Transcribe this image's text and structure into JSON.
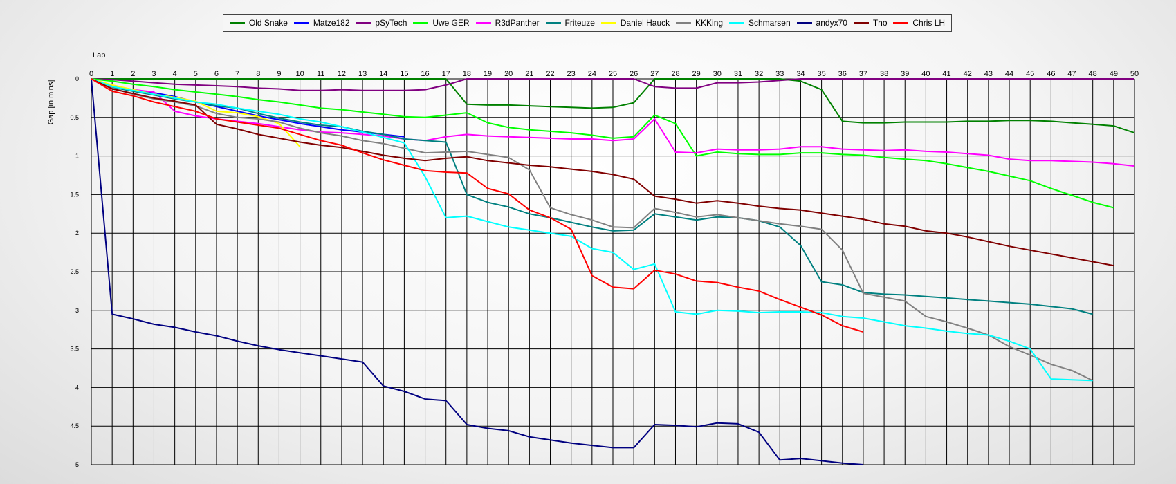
{
  "chart_data": {
    "type": "line",
    "xlabel": "Lap",
    "ylabel": "Gap [in mins]",
    "x_range": [
      0,
      50
    ],
    "y_range": [
      0,
      5
    ],
    "y_inverted": true,
    "x_ticks": [
      0,
      1,
      2,
      3,
      4,
      5,
      6,
      7,
      8,
      9,
      10,
      11,
      12,
      13,
      14,
      15,
      16,
      17,
      18,
      19,
      20,
      21,
      22,
      23,
      24,
      25,
      26,
      27,
      28,
      29,
      30,
      31,
      32,
      33,
      34,
      35,
      36,
      37,
      38,
      39,
      40,
      41,
      42,
      43,
      44,
      45,
      46,
      47,
      48,
      49,
      50
    ],
    "y_ticks": [
      "0",
      "0.5",
      "1",
      "1.5",
      "2",
      "2.5",
      "3",
      "3.5",
      "4",
      "4.5",
      "5"
    ],
    "grid": true,
    "legend_position": "top",
    "series": [
      {
        "name": "Old Snake",
        "color": "#008000",
        "x": [
          0,
          1,
          2,
          3,
          4,
          5,
          6,
          7,
          8,
          9,
          10,
          11,
          12,
          13,
          14,
          15,
          16,
          17,
          18,
          19,
          20,
          21,
          22,
          23,
          24,
          25,
          26,
          27,
          28,
          29,
          30,
          31,
          32,
          33,
          34,
          35,
          36,
          37,
          38,
          39,
          40,
          41,
          42,
          43,
          44,
          45,
          46,
          47,
          48,
          49,
          50
        ],
        "y": [
          0,
          0,
          0,
          0,
          0,
          0,
          0,
          0,
          0,
          0,
          0,
          0,
          0,
          0,
          0,
          0,
          0,
          0,
          0.33,
          0.34,
          0.34,
          0.35,
          0.36,
          0.37,
          0.38,
          0.37,
          0.31,
          0,
          0,
          0,
          0,
          0,
          0,
          0,
          0.03,
          0.14,
          0.55,
          0.57,
          0.57,
          0.56,
          0.56,
          0.56,
          0.55,
          0.55,
          0.54,
          0.54,
          0.55,
          0.57,
          0.59,
          0.61,
          0.7
        ]
      },
      {
        "name": "Matze182",
        "color": "#0000ff",
        "x": [
          0,
          1,
          2,
          3,
          4,
          5,
          6,
          7,
          8,
          9,
          10,
          11,
          12,
          13,
          14,
          15
        ],
        "y": [
          0,
          0.09,
          0.14,
          0.18,
          0.23,
          0.3,
          0.36,
          0.42,
          0.48,
          0.53,
          0.58,
          0.62,
          0.66,
          0.69,
          0.72,
          0.75
        ]
      },
      {
        "name": "pSyTech",
        "color": "#800080",
        "x": [
          0,
          1,
          2,
          3,
          4,
          5,
          6,
          7,
          8,
          9,
          10,
          11,
          12,
          13,
          14,
          15,
          16,
          17,
          18,
          19,
          20,
          21,
          22,
          23,
          24,
          25,
          26,
          27,
          28,
          29,
          30,
          31,
          32,
          33,
          34,
          35,
          36,
          37,
          38,
          39,
          40,
          41,
          42,
          43,
          44,
          45,
          46,
          47,
          48,
          49,
          50
        ],
        "y": [
          0,
          0.01,
          0.03,
          0.05,
          0.07,
          0.08,
          0.09,
          0.1,
          0.12,
          0.13,
          0.15,
          0.15,
          0.14,
          0.15,
          0.15,
          0.15,
          0.14,
          0.08,
          0,
          0,
          0,
          0,
          0,
          0,
          0,
          0,
          0,
          0.1,
          0.12,
          0.12,
          0.05,
          0.05,
          0.04,
          0.02,
          0,
          0,
          0,
          0,
          0,
          0,
          0,
          0,
          0,
          0,
          0,
          0,
          0,
          0,
          0,
          0,
          0
        ]
      },
      {
        "name": "Uwe GER",
        "color": "#00ff00",
        "x": [
          0,
          1,
          2,
          3,
          4,
          5,
          6,
          7,
          8,
          9,
          10,
          11,
          12,
          13,
          14,
          15,
          16,
          17,
          18,
          19,
          20,
          21,
          22,
          23,
          24,
          25,
          26,
          27,
          28,
          29,
          30,
          31,
          32,
          33,
          34,
          35,
          36,
          37,
          38,
          39,
          40,
          41,
          42,
          43,
          44,
          45,
          46,
          47,
          48,
          49
        ],
        "y": [
          0,
          0.03,
          0.07,
          0.1,
          0.14,
          0.17,
          0.2,
          0.23,
          0.27,
          0.3,
          0.34,
          0.38,
          0.4,
          0.43,
          0.46,
          0.49,
          0.5,
          0.47,
          0.44,
          0.57,
          0.63,
          0.66,
          0.68,
          0.7,
          0.73,
          0.77,
          0.75,
          0.47,
          0.58,
          1.0,
          0.95,
          0.97,
          0.98,
          0.98,
          0.96,
          0.96,
          0.98,
          0.99,
          1.02,
          1.04,
          1.06,
          1.1,
          1.15,
          1.2,
          1.26,
          1.32,
          1.42,
          1.51,
          1.6,
          1.67
        ]
      },
      {
        "name": "R3dPanther",
        "color": "#ff00ff",
        "x": [
          0,
          1,
          2,
          3,
          4,
          5,
          6,
          7,
          8,
          9,
          10,
          11,
          12,
          13,
          14,
          15,
          16,
          17,
          18,
          19,
          20,
          21,
          22,
          23,
          24,
          25,
          26,
          27,
          28,
          29,
          30,
          31,
          32,
          33,
          34,
          35,
          36,
          37,
          38,
          39,
          40,
          41,
          42,
          43,
          44,
          45,
          46,
          47,
          48,
          49,
          50
        ],
        "y": [
          0,
          0.1,
          0.14,
          0.17,
          0.42,
          0.48,
          0.52,
          0.55,
          0.58,
          0.62,
          0.66,
          0.69,
          0.7,
          0.72,
          0.74,
          0.78,
          0.8,
          0.75,
          0.72,
          0.74,
          0.75,
          0.76,
          0.77,
          0.78,
          0.78,
          0.8,
          0.78,
          0.52,
          0.95,
          0.96,
          0.91,
          0.92,
          0.92,
          0.91,
          0.88,
          0.88,
          0.91,
          0.92,
          0.93,
          0.92,
          0.94,
          0.95,
          0.97,
          0.99,
          1.04,
          1.06,
          1.06,
          1.07,
          1.08,
          1.1,
          1.13
        ]
      },
      {
        "name": "Friteuze",
        "color": "#008080",
        "x": [
          0,
          1,
          2,
          3,
          4,
          5,
          6,
          7,
          8,
          9,
          10,
          11,
          12,
          13,
          14,
          15,
          16,
          17,
          18,
          19,
          20,
          21,
          22,
          23,
          24,
          25,
          26,
          27,
          28,
          29,
          30,
          31,
          32,
          33,
          34,
          35,
          36,
          37,
          38,
          39,
          40,
          41,
          42,
          43,
          44,
          45,
          46,
          47,
          48
        ],
        "y": [
          0,
          0.11,
          0.16,
          0.21,
          0.26,
          0.3,
          0.35,
          0.38,
          0.45,
          0.51,
          0.56,
          0.6,
          0.62,
          0.68,
          0.72,
          0.78,
          0.8,
          0.82,
          1.5,
          1.6,
          1.66,
          1.75,
          1.8,
          1.86,
          1.92,
          1.97,
          1.96,
          1.75,
          1.79,
          1.83,
          1.79,
          1.8,
          1.84,
          1.92,
          2.16,
          2.63,
          2.67,
          2.77,
          2.79,
          2.8,
          2.82,
          2.84,
          2.86,
          2.88,
          2.9,
          2.92,
          2.95,
          2.98,
          3.05
        ]
      },
      {
        "name": "Daniel Hauck",
        "color": "#ffff00",
        "x": [
          0,
          1,
          2,
          3,
          4,
          5,
          6,
          7,
          8,
          9,
          10
        ],
        "y": [
          0,
          0.08,
          0.14,
          0.2,
          0.24,
          0.29,
          0.42,
          0.44,
          0.49,
          0.58,
          0.88
        ]
      },
      {
        "name": "KKKing",
        "color": "#808080",
        "x": [
          0,
          1,
          2,
          3,
          4,
          5,
          6,
          7,
          8,
          9,
          10,
          11,
          12,
          13,
          14,
          15,
          16,
          17,
          18,
          19,
          20,
          21,
          22,
          23,
          24,
          25,
          26,
          27,
          28,
          29,
          30,
          31,
          32,
          33,
          34,
          35,
          36,
          37,
          38,
          39,
          40,
          41,
          42,
          43,
          44,
          45,
          46,
          47,
          48
        ],
        "y": [
          0,
          0.12,
          0.2,
          0.26,
          0.3,
          0.35,
          0.45,
          0.5,
          0.52,
          0.56,
          0.64,
          0.7,
          0.74,
          0.8,
          0.84,
          0.9,
          0.96,
          0.95,
          0.94,
          0.98,
          1.02,
          1.18,
          1.67,
          1.76,
          1.83,
          1.92,
          1.93,
          1.68,
          1.73,
          1.79,
          1.76,
          1.8,
          1.84,
          1.88,
          1.91,
          1.95,
          2.22,
          2.78,
          2.83,
          2.88,
          3.08,
          3.15,
          3.23,
          3.32,
          3.47,
          3.58,
          3.7,
          3.78,
          3.91
        ]
      },
      {
        "name": "Schmarsen",
        "color": "#00ffff",
        "x": [
          0,
          1,
          2,
          3,
          4,
          5,
          6,
          7,
          8,
          9,
          10,
          11,
          12,
          13,
          14,
          15,
          16,
          17,
          18,
          19,
          20,
          21,
          22,
          23,
          24,
          25,
          26,
          27,
          28,
          29,
          30,
          31,
          32,
          33,
          34,
          35,
          36,
          37,
          38,
          39,
          40,
          41,
          42,
          43,
          44,
          45,
          46,
          47,
          48
        ],
        "y": [
          0,
          0.1,
          0.15,
          0.2,
          0.25,
          0.3,
          0.33,
          0.38,
          0.42,
          0.46,
          0.52,
          0.56,
          0.62,
          0.69,
          0.76,
          0.83,
          1.27,
          1.8,
          1.78,
          1.85,
          1.92,
          1.96,
          2.0,
          2.04,
          2.2,
          2.25,
          2.47,
          2.4,
          3.02,
          3.05,
          3.0,
          3.01,
          3.03,
          3.02,
          3.02,
          3.03,
          3.08,
          3.1,
          3.15,
          3.2,
          3.23,
          3.27,
          3.3,
          3.32,
          3.4,
          3.5,
          3.89,
          3.9,
          3.91
        ]
      },
      {
        "name": "andyx70",
        "color": "#000080",
        "x": [
          0,
          1,
          2,
          3,
          4,
          5,
          6,
          7,
          8,
          9,
          10,
          11,
          12,
          13,
          14,
          15,
          16,
          17,
          18,
          19,
          20,
          21,
          22,
          23,
          24,
          25,
          26,
          27,
          28,
          29,
          30,
          31,
          32,
          33,
          34,
          35,
          36,
          37
        ],
        "y": [
          0,
          3.05,
          3.11,
          3.18,
          3.22,
          3.28,
          3.33,
          3.4,
          3.46,
          3.51,
          3.55,
          3.59,
          3.63,
          3.67,
          3.98,
          4.05,
          4.15,
          4.17,
          4.48,
          4.53,
          4.56,
          4.64,
          4.68,
          4.72,
          4.75,
          4.78,
          4.78,
          4.48,
          4.49,
          4.51,
          4.46,
          4.47,
          4.58,
          4.94,
          4.92,
          4.95,
          4.98,
          5.0
        ]
      },
      {
        "name": "Tho",
        "color": "#800000",
        "x": [
          0,
          1,
          2,
          3,
          4,
          5,
          6,
          7,
          8,
          9,
          10,
          11,
          12,
          13,
          14,
          15,
          16,
          17,
          18,
          19,
          20,
          21,
          22,
          23,
          24,
          25,
          26,
          27,
          28,
          29,
          30,
          31,
          32,
          33,
          34,
          35,
          36,
          37,
          38,
          39,
          40,
          41,
          42,
          43,
          44,
          45,
          46,
          47,
          48,
          49
        ],
        "y": [
          0,
          0.13,
          0.19,
          0.25,
          0.29,
          0.34,
          0.59,
          0.65,
          0.72,
          0.77,
          0.82,
          0.86,
          0.89,
          0.94,
          0.99,
          1.03,
          1.06,
          1.03,
          1.01,
          1.06,
          1.09,
          1.12,
          1.14,
          1.17,
          1.2,
          1.24,
          1.3,
          1.52,
          1.56,
          1.61,
          1.58,
          1.61,
          1.65,
          1.68,
          1.7,
          1.74,
          1.78,
          1.82,
          1.88,
          1.91,
          1.97,
          2.0,
          2.05,
          2.11,
          2.17,
          2.22,
          2.27,
          2.32,
          2.37,
          2.42
        ]
      },
      {
        "name": "Chris LH",
        "color": "#ff0000",
        "x": [
          0,
          1,
          2,
          3,
          4,
          5,
          6,
          7,
          8,
          9,
          10,
          11,
          12,
          13,
          14,
          15,
          16,
          17,
          18,
          19,
          20,
          21,
          22,
          23,
          24,
          25,
          26,
          27,
          28,
          29,
          30,
          31,
          32,
          33,
          34,
          35,
          36,
          37
        ],
        "y": [
          0,
          0.16,
          0.22,
          0.3,
          0.36,
          0.42,
          0.52,
          0.56,
          0.6,
          0.64,
          0.72,
          0.8,
          0.86,
          0.96,
          1.05,
          1.12,
          1.19,
          1.21,
          1.22,
          1.42,
          1.49,
          1.7,
          1.8,
          1.95,
          2.55,
          2.7,
          2.72,
          2.48,
          2.53,
          2.62,
          2.64,
          2.7,
          2.75,
          2.86,
          2.96,
          3.06,
          3.2,
          3.28
        ]
      }
    ]
  }
}
